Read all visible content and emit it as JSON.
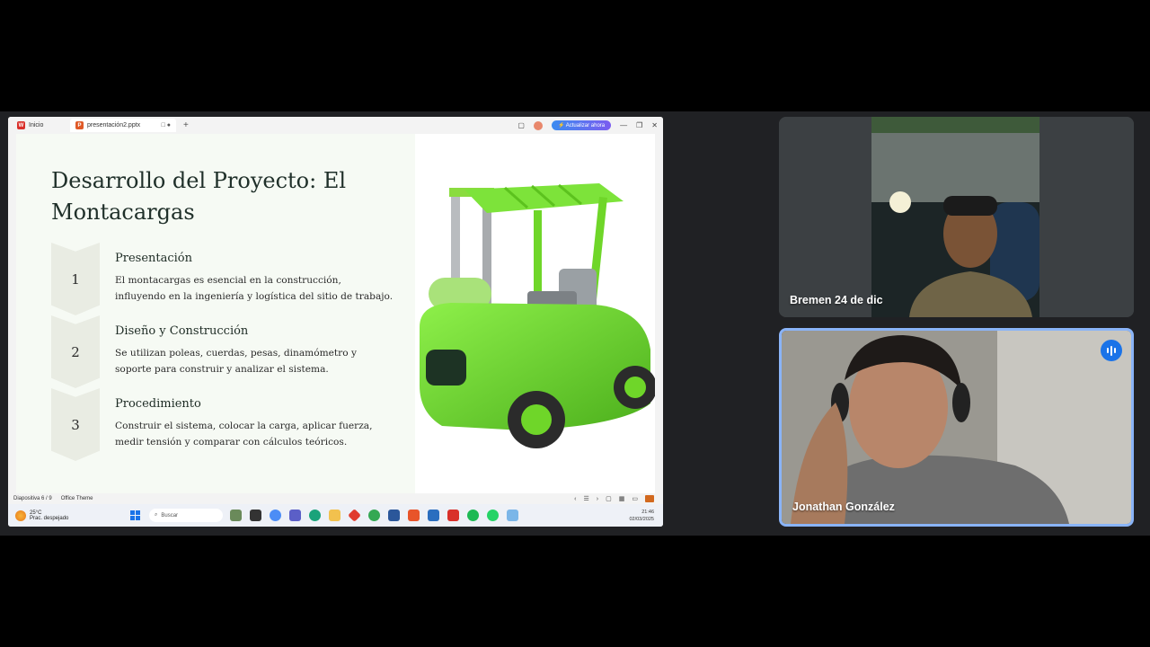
{
  "browser": {
    "home_tab": "Inicio",
    "doc_tab": "presentación2.pptx",
    "update_button": "⚡ Actualizar ahora"
  },
  "slide": {
    "title": "Desarrollo del Proyecto: El Montacargas",
    "steps": [
      {
        "number": "1",
        "title": "Presentación",
        "text": "El montacargas es esencial en la construcción, influyendo en la ingeniería y logística del sitio de trabajo."
      },
      {
        "number": "2",
        "title": "Diseño y Construcción",
        "text": "Se utilizan poleas, cuerdas, pesas, dinamómetro y soporte para construir y analizar el sistema."
      },
      {
        "number": "3",
        "title": "Procedimiento",
        "text": "Construir el sistema, colocar la carga, aplicar fuerza, medir tensión y comparar con cálculos teóricos."
      }
    ]
  },
  "status": {
    "slide_counter": "Diapositiva 6 / 9",
    "theme": "Office Theme"
  },
  "taskbar": {
    "temperature": "25°C",
    "weather": "Prac. despejado",
    "search_placeholder": "Buscar",
    "time": "21:46",
    "date": "02/03/2025"
  },
  "participants": [
    {
      "name": "Bremen 24 de dic"
    },
    {
      "name": "Jonathan González"
    }
  ],
  "colors": {
    "meet_bg": "#202124",
    "active_speaker_border": "#8ab4f8",
    "forklift_green": "#6fd629"
  }
}
